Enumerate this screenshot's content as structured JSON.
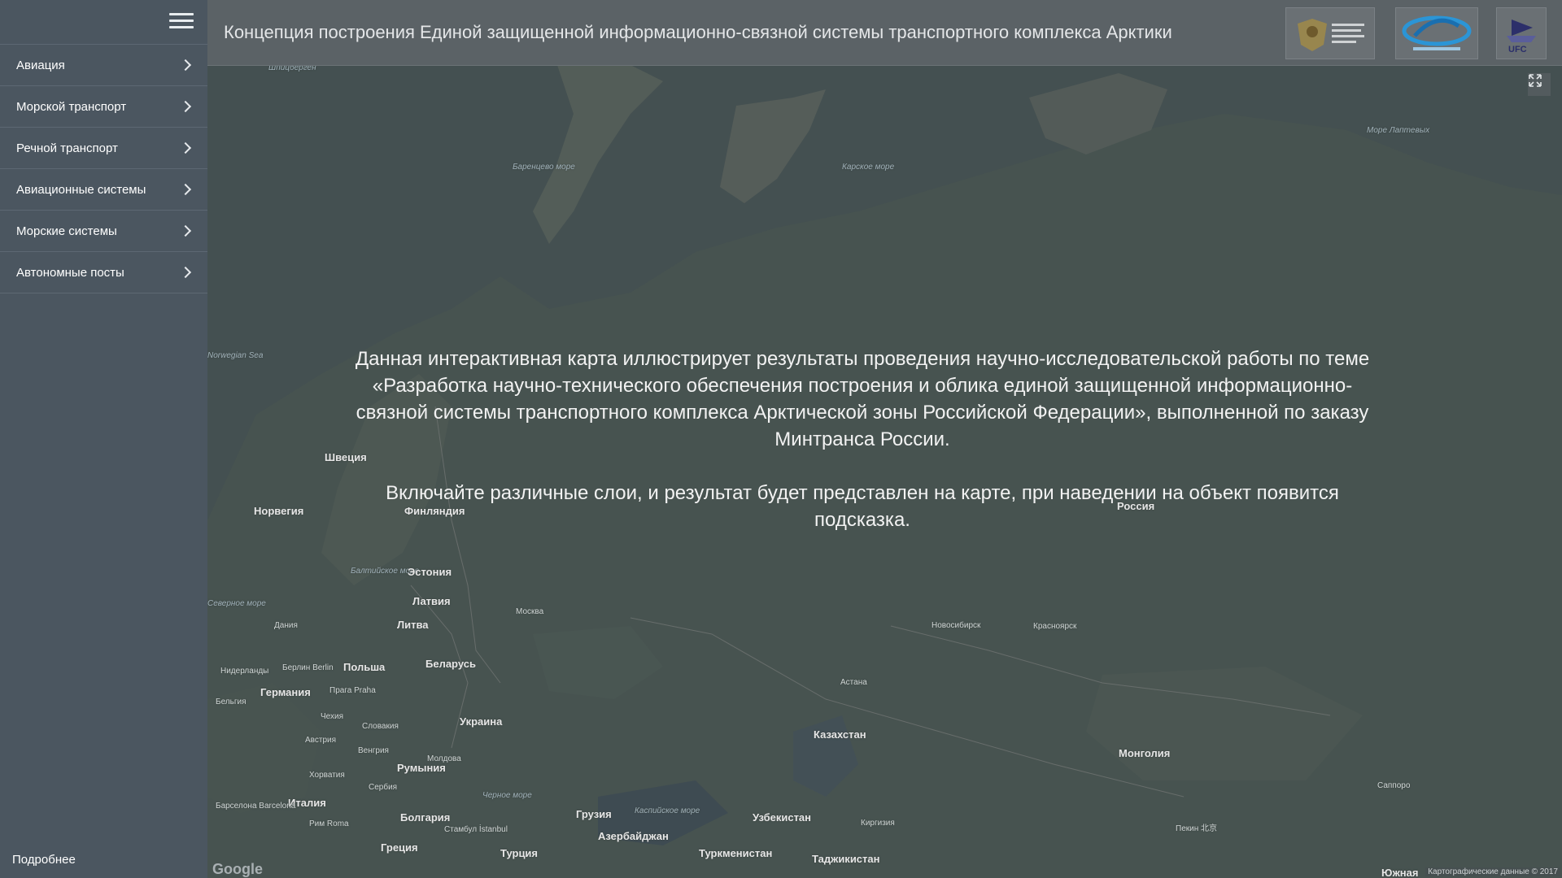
{
  "sidebar": {
    "items": [
      {
        "label": "Авиация"
      },
      {
        "label": "Морской транспорт"
      },
      {
        "label": "Речной транспорт"
      },
      {
        "label": "Авиационные системы"
      },
      {
        "label": "Морские системы"
      },
      {
        "label": "Автономные посты"
      }
    ],
    "more_label": "Подробнее"
  },
  "header": {
    "title": "Концепция построения Единой защищенной информационно-связной системы транспортного комплекса Арктики",
    "logos": [
      {
        "name": "mintrans-logo",
        "icon": "coat-of-arms"
      },
      {
        "name": "zashchitainfotrans-logo",
        "icon": "ellipse-emblem"
      },
      {
        "name": "ufk-logo",
        "icon": "ship-emblem"
      }
    ]
  },
  "info": {
    "paragraph1": "Данная интерактивная карта иллюстрирует результаты проведения научно-исследовательской работы по теме «Разработка научно-технического обеспечения построения и облика единой защищенной информационно-связной системы транспортного комплекса Арктической зоны Российской Федерации», выполненной по заказу Минтранса России.",
    "paragraph2": "Включайте различные слои, и результат будет представлен на карте, при наведении на объект появится подсказка."
  },
  "map": {
    "labels": {
      "russia": "Россия",
      "sweden": "Швеция",
      "norway": "Норвегия",
      "finland": "Финляндия",
      "estonia": "Эстония",
      "latvia": "Латвия",
      "lithuania": "Литва",
      "belarus": "Беларусь",
      "poland": "Польша",
      "germany": "Германия",
      "ukraine": "Украина",
      "kazakhstan": "Казахстан",
      "mongolia": "Монголия",
      "romania": "Румыния",
      "bulgaria": "Болгария",
      "turkey": "Турция",
      "georgia": "Грузия",
      "azerbaijan": "Азербайджан",
      "uzbekistan": "Узбекистан",
      "turkmenistan": "Туркменистан",
      "tajikistan": "Таджикистан",
      "kyrgyzstan": "Киргизия",
      "italy": "Италия",
      "greece": "Греция",
      "czech": "Чехия",
      "austria": "Австрия",
      "moldova": "Молдова",
      "moscow": "Москва",
      "astana": "Астана",
      "novosibirsk": "Новосибирск",
      "krasnoyarsk": "Красноярск",
      "denmark": "Дания",
      "netherlands": "Нидерланды",
      "belgium": "Бельгия",
      "barents_sea": "Баренцево море",
      "kara_sea": "Карское море",
      "laptev_sea": "Море Лаптевых",
      "baltic_sea": "Балтийское море",
      "black_sea": "Черное море",
      "caspian_sea": "Каспийское море",
      "norwegian_sea": "Norwegian Sea",
      "north_sea": "Северное море",
      "svalbard": "Шпицберген",
      "berlin": "Берлин Berlin",
      "prague": "Прага Praha",
      "rome": "Рим Roma",
      "istanbul": "Стамбул İstanbul",
      "barcelona": "Барселона Barcelona",
      "beijing": "Пекин 北京",
      "sapporo": "Саппоро",
      "slovakia": "Словакия",
      "hungary": "Венгрия",
      "serbia": "Сербия",
      "croatia": "Хорватия",
      "south": "Южная"
    },
    "google": "Google",
    "credit": "Картографические данные © 2017"
  }
}
